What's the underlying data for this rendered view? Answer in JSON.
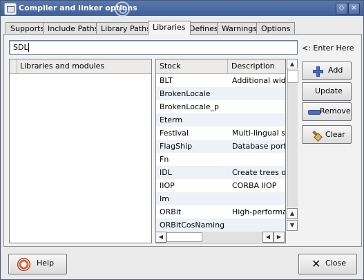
{
  "window": {
    "title": "Compiler and linker options"
  },
  "tabs": [
    {
      "label": "Supports"
    },
    {
      "label": "Include Paths"
    },
    {
      "label": "Library Paths"
    },
    {
      "label": "Libraries",
      "active": true
    },
    {
      "label": "Defines"
    },
    {
      "label": "Warnings"
    },
    {
      "label": "Options"
    }
  ],
  "input": {
    "value": "SDL",
    "hint": "<: Enter Here"
  },
  "libraries": {
    "header": "Libraries and modules"
  },
  "stock": {
    "headers": {
      "stock": "Stock",
      "description": "Description"
    },
    "rows": [
      {
        "stock": "BLT",
        "description": "Additional widge"
      },
      {
        "stock": "BrokenLocale",
        "description": ""
      },
      {
        "stock": "BrokenLocale_p",
        "description": ""
      },
      {
        "stock": "Eterm",
        "description": ""
      },
      {
        "stock": "Festival",
        "description": "Multi-lingual spe"
      },
      {
        "stock": "FlagShip",
        "description": "Database portin"
      },
      {
        "stock": "Fn",
        "description": ""
      },
      {
        "stock": "IDL",
        "description": "Create trees of c"
      },
      {
        "stock": "IIOP",
        "description": "CORBA IIOP"
      },
      {
        "stock": "Im",
        "description": ""
      },
      {
        "stock": "ORBit",
        "description": "High-performan"
      },
      {
        "stock": "ORBitCosNaming",
        "description": ""
      }
    ]
  },
  "buttons": {
    "add": "Add",
    "update": "Update",
    "remove": "Remove",
    "clear": "Clear",
    "help": "Help",
    "close": "Close"
  },
  "icons": {
    "add": "plus-icon",
    "remove": "minus-icon",
    "clear": "brush-icon",
    "help": "lifebuoy-icon",
    "close": "x-icon"
  }
}
